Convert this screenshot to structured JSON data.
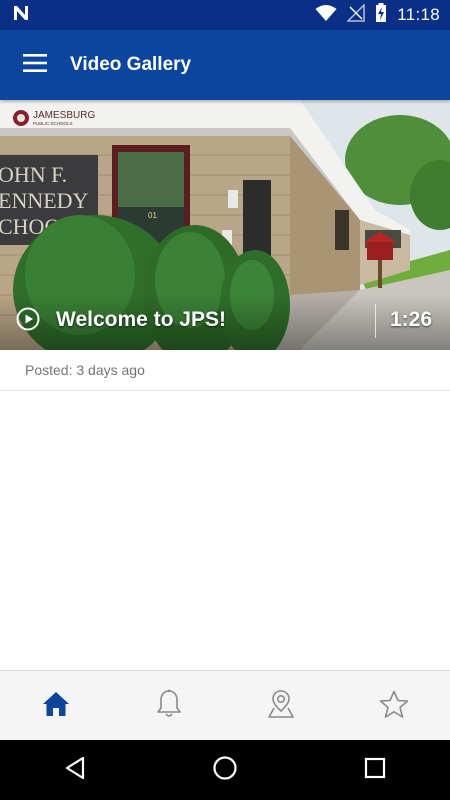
{
  "status_bar": {
    "time": "11:18",
    "icons": [
      "notification-n-icon",
      "wifi-icon",
      "no-signal-icon",
      "battery-charging-icon"
    ]
  },
  "app_bar": {
    "title": "Video Gallery",
    "menu_icon": "hamburger-menu-icon"
  },
  "video": {
    "title": "Welcome to JPS!",
    "duration": "1:26",
    "posted": "Posted: 3 days ago",
    "logo_text": "JAMESBURG",
    "logo_subtext": "PUBLIC SCHOOLS",
    "sign_lines": [
      "OHN F.",
      "ENNEDY",
      "CHOO"
    ],
    "door_number": "01"
  },
  "bottom_nav": {
    "items": [
      {
        "icon": "home-icon",
        "active": true
      },
      {
        "icon": "bell-icon",
        "active": false
      },
      {
        "icon": "map-pin-icon",
        "active": false
      },
      {
        "icon": "star-icon",
        "active": false
      }
    ],
    "active_color": "#0b45a0",
    "inactive_color": "#8a8a8a"
  },
  "colors": {
    "status_bar": "#0a2f86",
    "app_bar": "#0b45a0"
  }
}
